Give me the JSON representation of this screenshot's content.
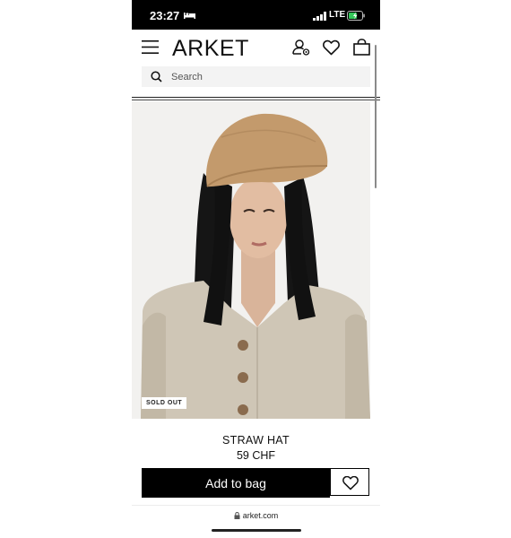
{
  "status_bar": {
    "time": "23:27",
    "network": "LTE"
  },
  "header": {
    "logo": "ARKET"
  },
  "search": {
    "placeholder": "Search"
  },
  "product": {
    "badge": "SOLD OUT",
    "name": "STRAW HAT",
    "price": "59 CHF"
  },
  "actions": {
    "add_to_bag": "Add to bag"
  },
  "browser": {
    "url": "arket.com"
  },
  "icons": [
    "menu-icon",
    "account-icon",
    "heart-icon",
    "bag-icon",
    "search-icon",
    "lock-icon"
  ]
}
